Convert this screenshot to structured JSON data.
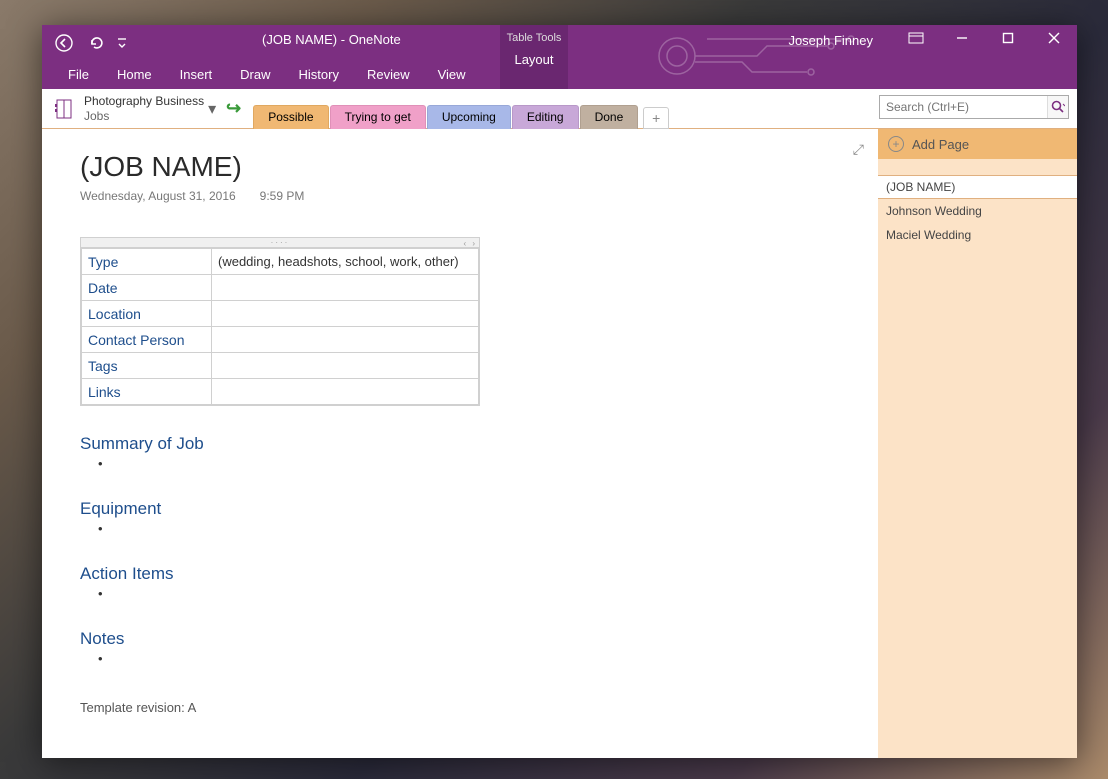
{
  "title": {
    "doc": "(JOB NAME)",
    "sep": "  -  ",
    "app": "OneNote"
  },
  "tabletools": {
    "label": "Table Tools",
    "tab": "Layout"
  },
  "user": "Joseph Finney",
  "menu": {
    "file": "File",
    "home": "Home",
    "insert": "Insert",
    "draw": "Draw",
    "history": "History",
    "review": "Review",
    "view": "View"
  },
  "notebook": {
    "name": "Photography Business",
    "section_group": "Jobs"
  },
  "sections": {
    "possible": "Possible",
    "trying": "Trying to get",
    "upcoming": "Upcoming",
    "editing": "Editing",
    "done": "Done"
  },
  "search": {
    "placeholder": "Search (Ctrl+E)"
  },
  "page": {
    "title": "(JOB NAME)",
    "date": "Wednesday, August 31, 2016",
    "time": "9:59 PM",
    "rows": {
      "type_label": "Type",
      "type_value": "(wedding, headshots, school, work, other)",
      "date_label": "Date",
      "date_value": "",
      "location_label": "Location",
      "location_value": "",
      "contact_label": "Contact Person",
      "contact_value": "",
      "tags_label": "Tags",
      "tags_value": "",
      "links_label": "Links",
      "links_value": ""
    },
    "sections": {
      "summary": "Summary of Job",
      "equipment": "Equipment",
      "actions": "Action Items",
      "notes": "Notes"
    },
    "template_rev": "Template revision: A"
  },
  "pagepane": {
    "add": "Add Page",
    "items": [
      {
        "label": "(JOB NAME)"
      },
      {
        "label": "Johnson Wedding"
      },
      {
        "label": "Maciel  Wedding"
      }
    ]
  }
}
